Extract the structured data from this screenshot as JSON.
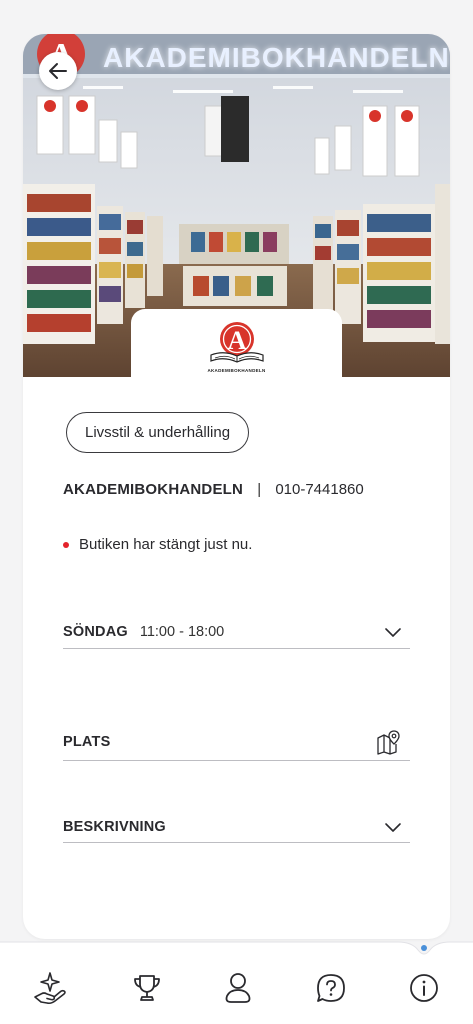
{
  "hero": {
    "sign_text": "AKADEMIBOKHANDELN",
    "logo_wordmark": "AKADEMIBOKHANDELN",
    "back_icon": "arrow-left-icon"
  },
  "category_chip": "Livsstil & underhålling",
  "store": {
    "name": "AKADEMIBOKHANDELN",
    "separator": "|",
    "phone": "010-7441860"
  },
  "status": {
    "text": "Butiken har stängt just nu.",
    "dot_color": "#e4232b"
  },
  "hours": {
    "day": "SÖNDAG",
    "time": "11:00 - 18:00",
    "icon": "chevron-down-icon"
  },
  "location": {
    "label": "PLATS",
    "icon": "map-pin-icon"
  },
  "description": {
    "label": "BESKRIVNING",
    "icon": "chevron-down-icon"
  },
  "tabbar": {
    "tabs": [
      {
        "icon": "hand-sparkle-icon"
      },
      {
        "icon": "trophy-icon"
      },
      {
        "icon": "user-icon"
      },
      {
        "icon": "help-icon"
      },
      {
        "icon": "info-icon",
        "active": true
      }
    ],
    "active_color": "#4a90d9"
  }
}
